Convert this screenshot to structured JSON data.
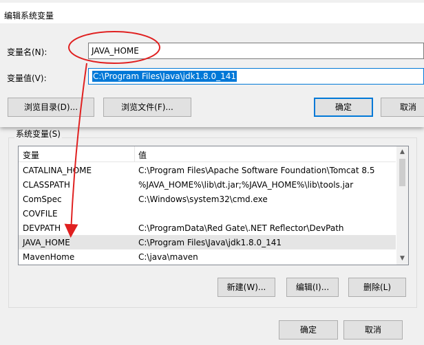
{
  "edit_dialog": {
    "title": "编辑系统变量",
    "var_name_label": "变量名(N):",
    "var_name_value": "JAVA_HOME",
    "var_value_label": "变量值(V):",
    "var_value_value": "C:\\Program Files\\Java\\jdk1.8.0_141",
    "browse_dir_button": "浏览目录(D)...",
    "browse_file_button": "浏览文件(F)...",
    "ok_button": "确定",
    "cancel_button": "取消"
  },
  "system_variables": {
    "group_title": "系统变量(S)",
    "columns": [
      "变量",
      "值"
    ],
    "rows": [
      {
        "name": "CATALINA_HOME",
        "value": "C:\\Program Files\\Apache Software Foundation\\Tomcat 8.5"
      },
      {
        "name": "CLASSPATH",
        "value": "%JAVA_HOME%\\lib\\dt.jar;%JAVA_HOME%\\lib\\tools.jar"
      },
      {
        "name": "ComSpec",
        "value": "C:\\Windows\\system32\\cmd.exe"
      },
      {
        "name": "COVFILE",
        "value": ""
      },
      {
        "name": "DEVPATH",
        "value": "C:\\ProgramData\\Red Gate\\.NET Reflector\\DevPath"
      },
      {
        "name": "JAVA_HOME",
        "value": "C:\\Program Files\\Java\\jdk1.8.0_141"
      },
      {
        "name": "MavenHome",
        "value": "C:\\java\\maven"
      }
    ],
    "selected_row": "JAVA_HOME",
    "new_button": "新建(W)...",
    "edit_button": "编辑(I)...",
    "delete_button": "删除(L)"
  },
  "parent_dialog": {
    "ok_button": "确定",
    "cancel_button": "取消"
  },
  "colors": {
    "annotation": "#e02020",
    "selection": "#0078d7"
  }
}
